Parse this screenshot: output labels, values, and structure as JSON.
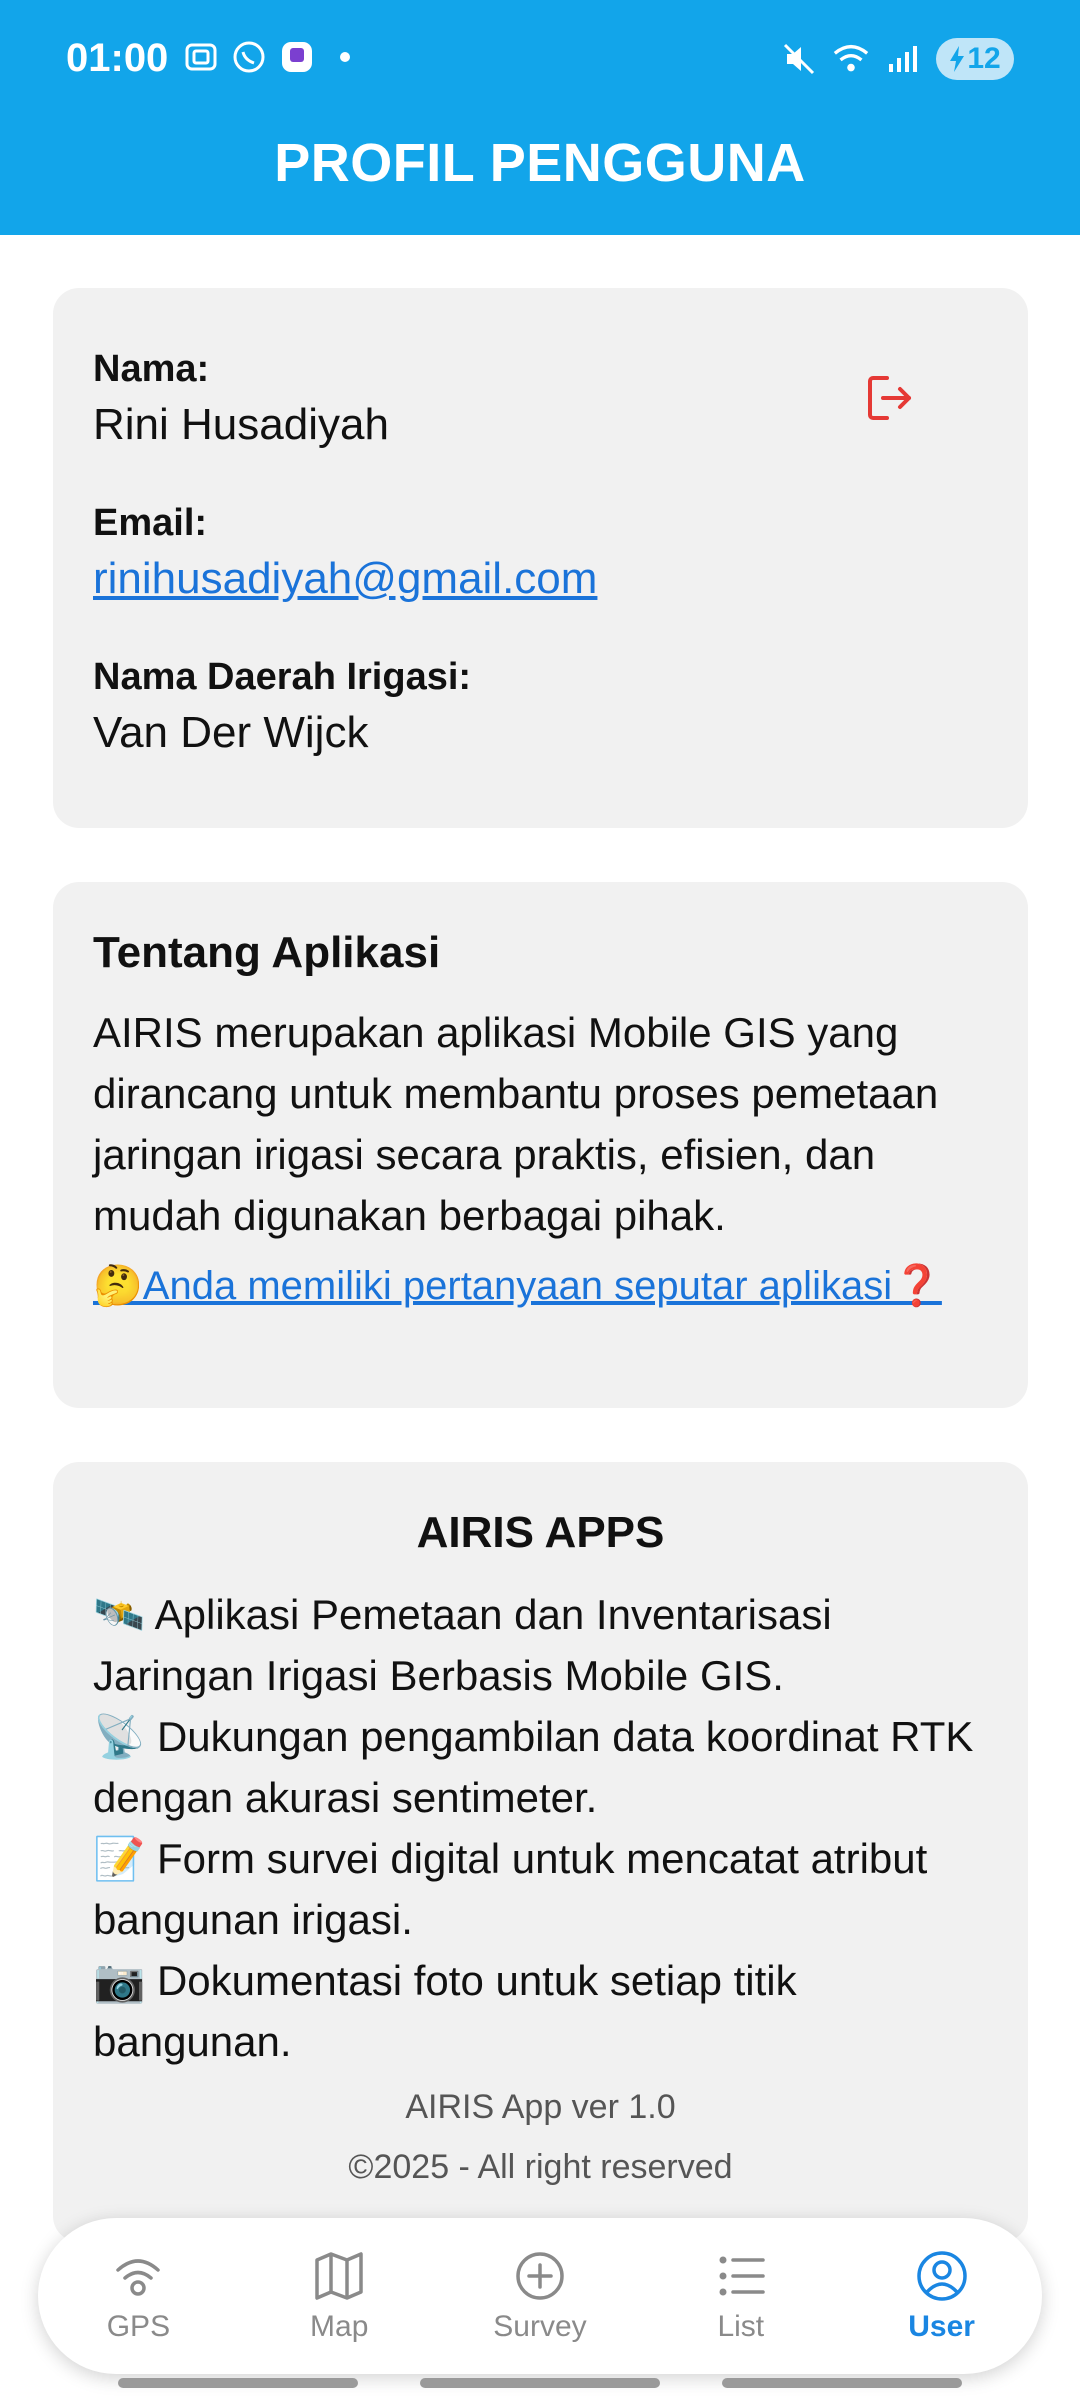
{
  "status_bar": {
    "time": "01:00",
    "battery": "12"
  },
  "header": {
    "title": "PROFIL PENGGUNA"
  },
  "profile": {
    "name_label": "Nama:",
    "name_value": "Rini Husadiyah",
    "email_label": "Email:",
    "email_value": "rinihusadiyah@gmail.com",
    "region_label": "Nama Daerah Irigasi:",
    "region_value": "Van Der Wijck"
  },
  "about": {
    "title": "Tentang Aplikasi",
    "description": "AIRIS merupakan aplikasi Mobile GIS yang dirancang untuk membantu proses pemetaan jaringan irigasi secara praktis, efisien, dan mudah digunakan berbagai pihak.",
    "question_link": "🤔Anda memiliki pertanyaan seputar aplikasi❓"
  },
  "apps": {
    "title": "AIRIS APPS",
    "features": [
      "🛰️ Aplikasi Pemetaan dan Inventarisasi Jaringan Irigasi Berbasis Mobile GIS.",
      "📡 Dukungan pengambilan data koordinat RTK dengan akurasi sentimeter.",
      "📝 Form survei digital untuk mencatat atribut bangunan irigasi.",
      "📷 Dokumentasi foto untuk setiap titik bangunan."
    ],
    "version": "AIRIS App ver 1.0",
    "copyright": "©2025 - All right reserved"
  },
  "nav": {
    "items": [
      {
        "label": "GPS",
        "icon": "gps-signal-icon",
        "active": false
      },
      {
        "label": "Map",
        "icon": "map-icon",
        "active": false
      },
      {
        "label": "Survey",
        "icon": "plus-circle-icon",
        "active": false
      },
      {
        "label": "List",
        "icon": "list-icon",
        "active": false
      },
      {
        "label": "User",
        "icon": "user-circle-icon",
        "active": true
      }
    ]
  },
  "colors": {
    "header_bg": "#12a5ea",
    "card_bg": "#f1f1f1",
    "link": "#1a73d9",
    "active_nav": "#1a86e2",
    "logout_icon": "#e53935"
  }
}
